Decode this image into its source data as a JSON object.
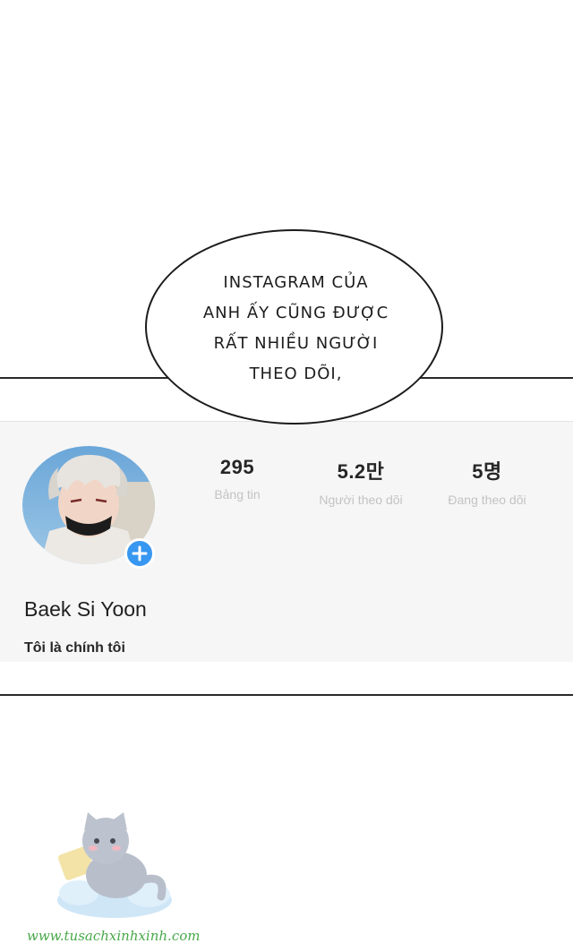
{
  "speech_bubble": {
    "lines": [
      "INSTAGRAM CỦA",
      "ANH ẤY CŨNG ĐƯỢC",
      "RẤT NHIỀU NGƯỜI",
      "THEO DÕI,"
    ]
  },
  "profile": {
    "stats": [
      {
        "value": "295",
        "label": "Bảng tin"
      },
      {
        "value": "5.2만",
        "label": "Người theo dõi"
      },
      {
        "value": "5명",
        "label": "Đang theo dõi"
      }
    ],
    "name": "Baek Si Yoon",
    "bio": "Tôi là chính tôi",
    "add_icon": "plus-icon",
    "accent_color": "#3897f0"
  },
  "watermark": {
    "text": "www.tusachxinhxinh.com"
  }
}
